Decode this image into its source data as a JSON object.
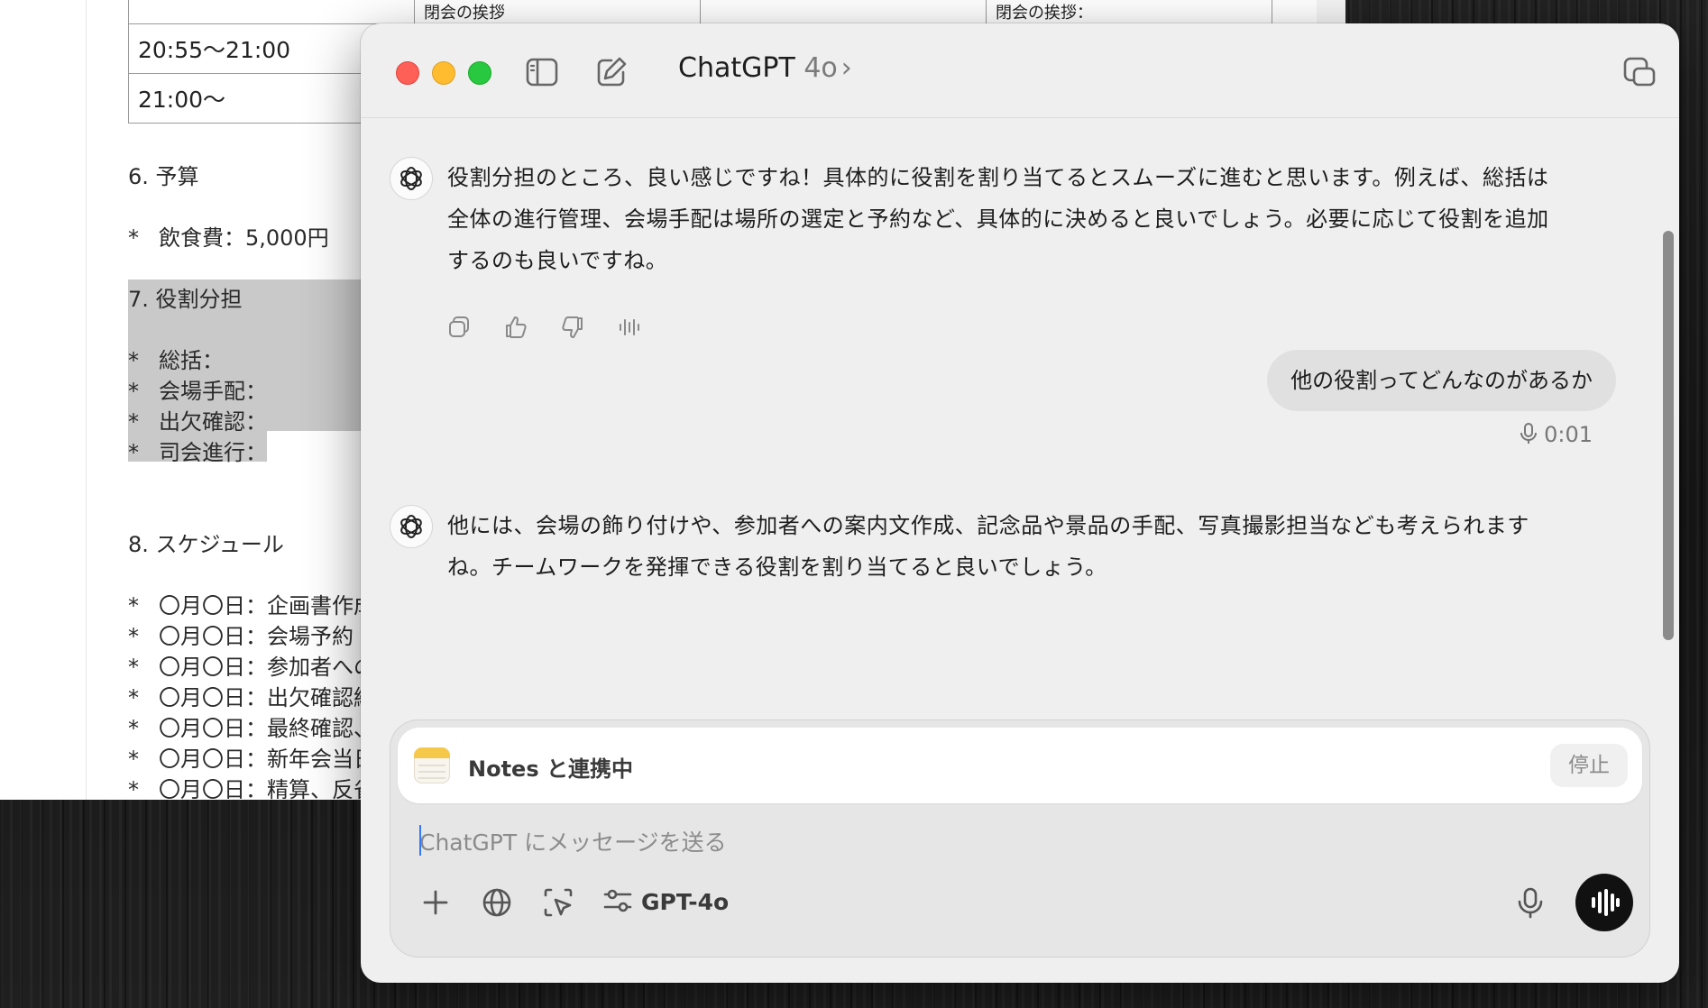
{
  "document": {
    "table_rows": [
      {
        "time": "20:55〜21:00",
        "c2": "閉会の挨拶",
        "c3": "",
        "c4": "閉会の挨拶："
      },
      {
        "time": "21:00〜",
        "c2": "",
        "c3": "",
        "c4": ""
      }
    ],
    "budget_heading": "6. 予算",
    "budget_items": [
      "飲食費：5,000円"
    ],
    "roles_heading": "7. 役割分担",
    "role_items": [
      "総括：",
      "会場手配：",
      "出欠確認：",
      "司会進行："
    ],
    "schedule_heading": "8. スケジュール",
    "schedule_items": [
      "〇月〇日：企画書作成",
      "〇月〇日：会場予約",
      "〇月〇日：参加者への",
      "〇月〇日：出欠確認締",
      "〇月〇日：最終確認、",
      "〇月〇日：新年会当日",
      "〇月〇日：精算、反省"
    ],
    "bullet": "*"
  },
  "window": {
    "title": "ChatGPT",
    "model_version": "4o",
    "title_chevron": "›"
  },
  "conversation": {
    "assistant_1": "役割分担のところ、良い感じですね！具体的に役割を割り当てるとスムーズに進むと思います。例えば、総括は全体の進行管理、会場手配は場所の選定と予約など、具体的に決めると良いでしょう。必要に応じて役割を追加するのも良いですね。",
    "user_1": "他の役割ってどんなのがあるか",
    "user_1_voice_duration": "0:01",
    "assistant_2": "他には、会場の飾り付けや、参加者への案内文作成、記念品や景品の手配、写真撮影担当なども考えられますね。チームワークを発揮できる役割を割り当てると良いでしょう。"
  },
  "composer": {
    "integration_label": "Notes と連携中",
    "stop_label": "停止",
    "placeholder": "ChatGPT にメッセージを送る",
    "model_label": "GPT-4o"
  },
  "colors": {
    "close": "#fe5f57",
    "minimize": "#febc2e",
    "maximize": "#28c840",
    "voice_button": "#111111",
    "notes_accent": "#f6c84a",
    "caret": "#3478f6"
  },
  "icons": {
    "toolbar": [
      "sidebar-icon",
      "compose-icon",
      "popout-icon"
    ],
    "message_actions": [
      "copy-icon",
      "thumbs-up-icon",
      "thumbs-down-icon",
      "read-aloud-icon"
    ],
    "composer_tools": [
      "plus-icon",
      "globe-icon",
      "screen-capture-icon",
      "sliders-icon",
      "microphone-icon",
      "voice-waveform-icon"
    ]
  }
}
